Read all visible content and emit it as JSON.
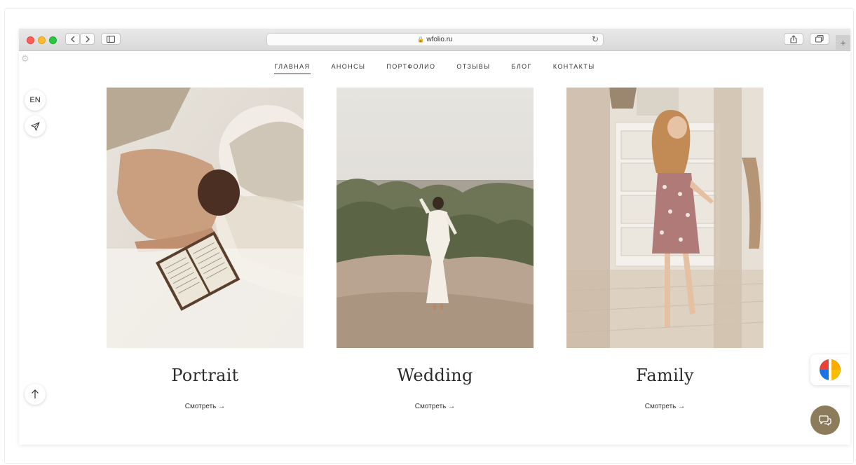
{
  "browser": {
    "url": "wfolio.ru",
    "back_icon": "chevron-left-icon",
    "forward_icon": "chevron-right-icon",
    "sidebar_icon": "sidebar-icon",
    "reload_icon": "reload-icon",
    "share_icon": "share-icon",
    "tabs_icon": "tabs-icon",
    "new_tab_label": "+"
  },
  "nav": {
    "items": [
      {
        "label": "ГЛАВНАЯ",
        "active": true
      },
      {
        "label": "АНОНСЫ"
      },
      {
        "label": "ПОРТФОЛИО"
      },
      {
        "label": "ОТЗЫВЫ"
      },
      {
        "label": "БЛОГ"
      },
      {
        "label": "КОНТАКТЫ"
      }
    ]
  },
  "side": {
    "lang": "EN",
    "settings_icon": "gear-icon",
    "send_icon": "send-icon",
    "up_icon": "arrow-up-icon"
  },
  "cards": [
    {
      "title": "Portrait",
      "link": "Смотреть →"
    },
    {
      "title": "Wedding",
      "link": "Смотреть →"
    },
    {
      "title": "Family",
      "link": "Смотреть →"
    }
  ],
  "colors": {
    "chat_button": "#8c7c5c",
    "text": "#2b2b2b"
  }
}
